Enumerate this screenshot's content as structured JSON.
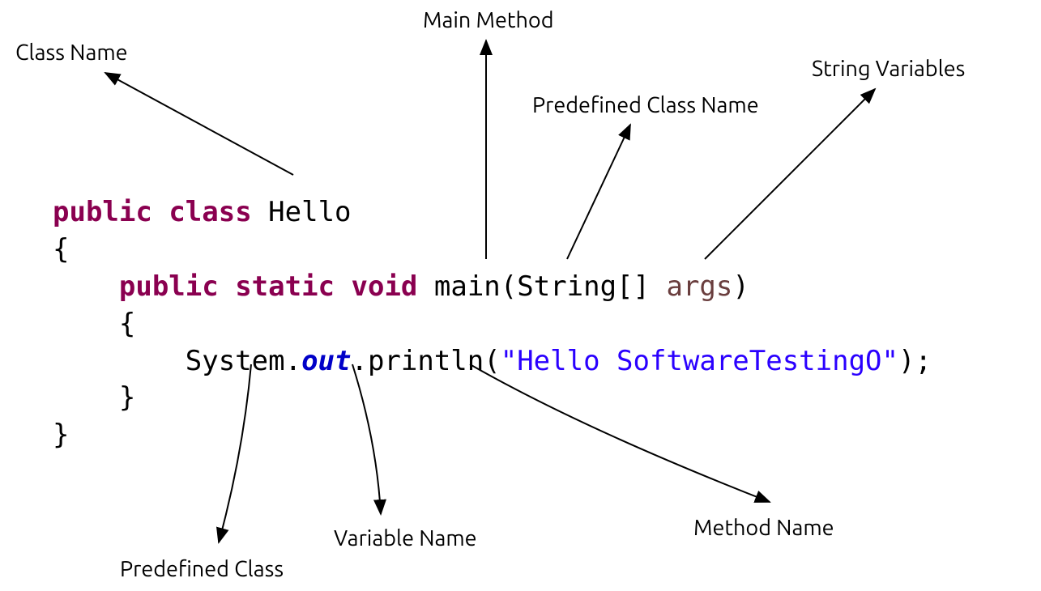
{
  "labels": {
    "class_name": "Class Name",
    "main_method": "Main Method",
    "predefined_class_name": "Predefined Class Name",
    "string_variables": "String Variables",
    "predefined_class": "Predefined Class",
    "variable_name": "Variable Name",
    "method_name": "Method Name"
  },
  "code": {
    "public": "public",
    "class": "class",
    "hello": "Hello",
    "brace_open": "{",
    "brace_close": "}",
    "static": "static",
    "void": "void",
    "main_sig_pre": "main(String[] ",
    "args": "args",
    "close_paren": ")",
    "system": "System.",
    "out": "out",
    "println": ".println(",
    "string_literal": "\"Hello SoftwareTestingO\"",
    "println_end": ");"
  }
}
